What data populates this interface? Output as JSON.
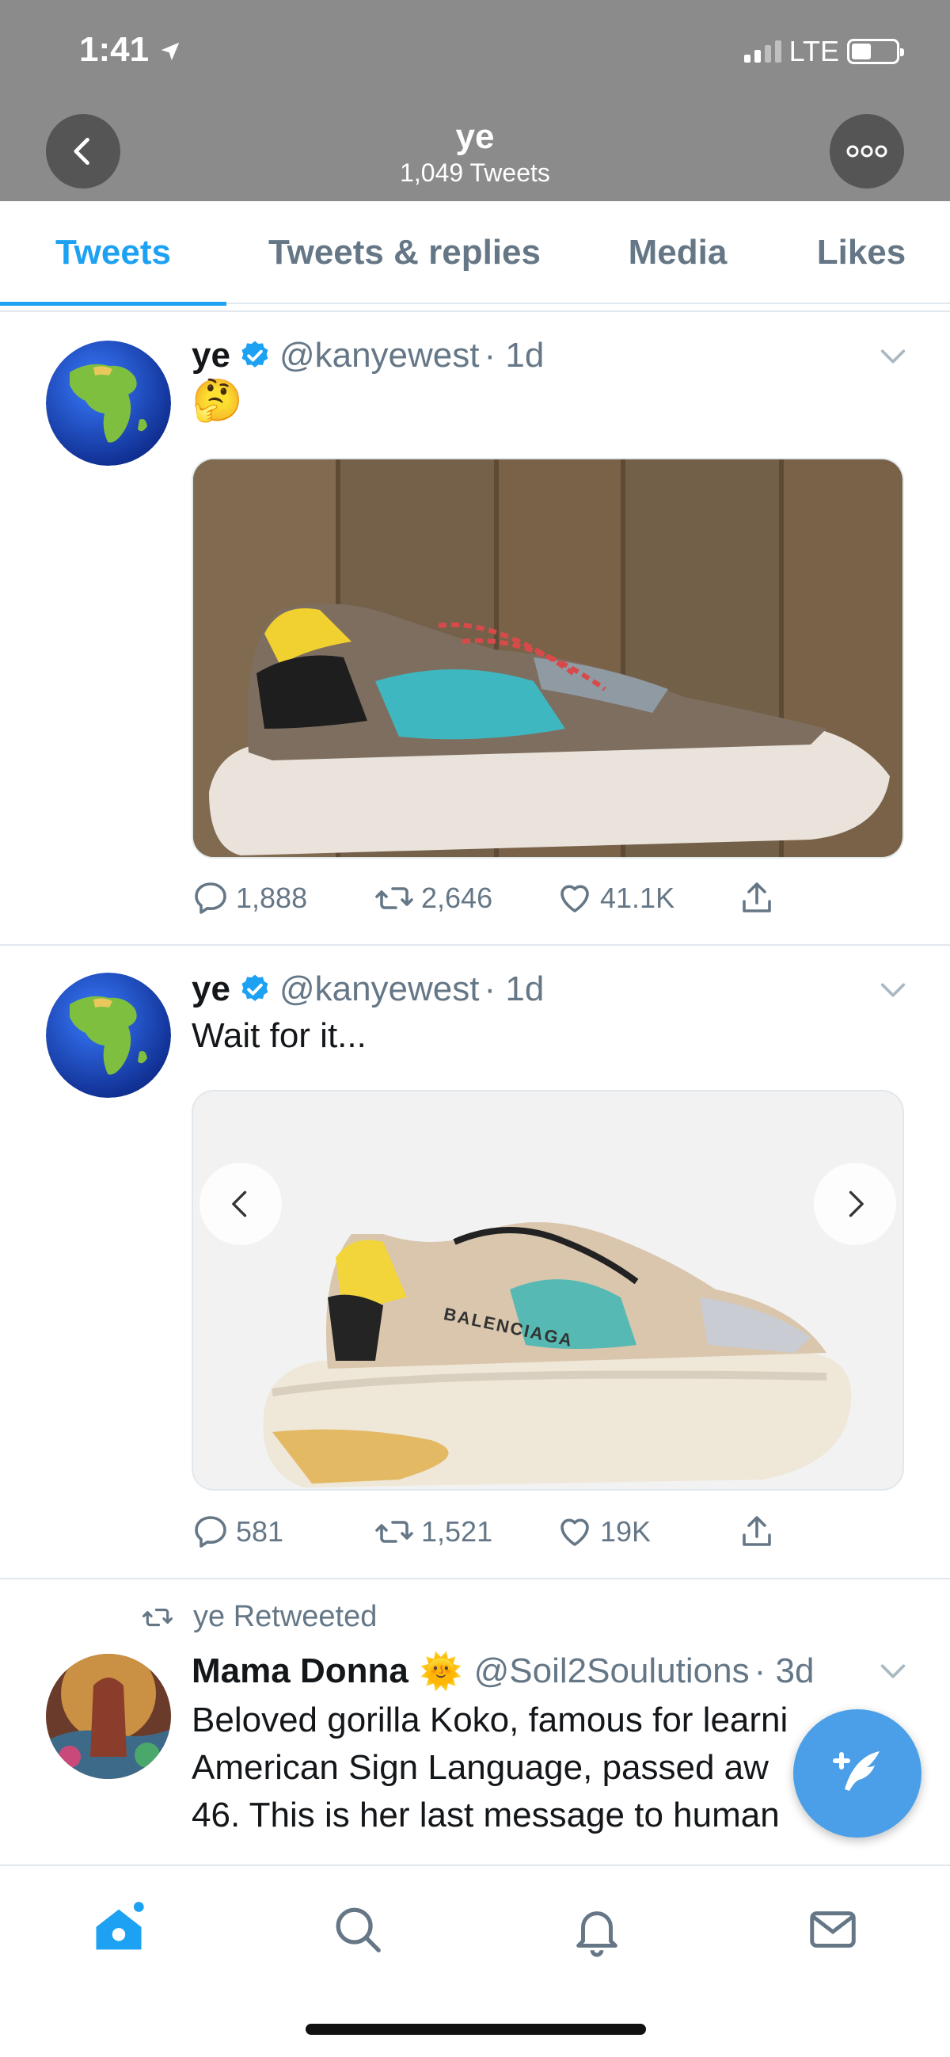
{
  "status_bar": {
    "time": "1:41",
    "network": "LTE"
  },
  "profile_header": {
    "name": "ye",
    "tweet_count": "1,049 Tweets"
  },
  "tabs": [
    {
      "label": "Tweets",
      "active": true
    },
    {
      "label": "Tweets & replies",
      "active": false
    },
    {
      "label": "Media",
      "active": false
    },
    {
      "label": "Likes",
      "active": false
    }
  ],
  "tweets": [
    {
      "name": "ye",
      "handle": "@kanyewest",
      "time": "· 1d",
      "text": "🤔",
      "media": "sneaker-photo-wood-background",
      "replies": "1,888",
      "retweets": "2,646",
      "likes": "41.1K"
    },
    {
      "name": "ye",
      "handle": "@kanyewest",
      "time": "· 1d",
      "text": "Wait for it...",
      "media": "balenciaga-triple-s-sneaker",
      "media_brand": "BALENCIAGA",
      "replies": "581",
      "retweets": "1,521",
      "likes": "19K"
    },
    {
      "retweeted_by": "ye Retweeted",
      "name": "Mama Donna",
      "name_emoji": "🌞",
      "handle": "@Soil2Soulutions",
      "time": "· 3d",
      "text_lines": [
        "Beloved gorilla Koko, famous for learni",
        "American Sign Language, passed aw",
        "46. This is her last message to human"
      ]
    }
  ],
  "colors": {
    "accent": "#1da1f2",
    "header_bg": "#8b8b8b",
    "muted": "#657786",
    "fab": "#4a9fe8"
  },
  "bottom_nav": [
    "home-icon",
    "search-icon",
    "notifications-icon",
    "messages-icon"
  ]
}
